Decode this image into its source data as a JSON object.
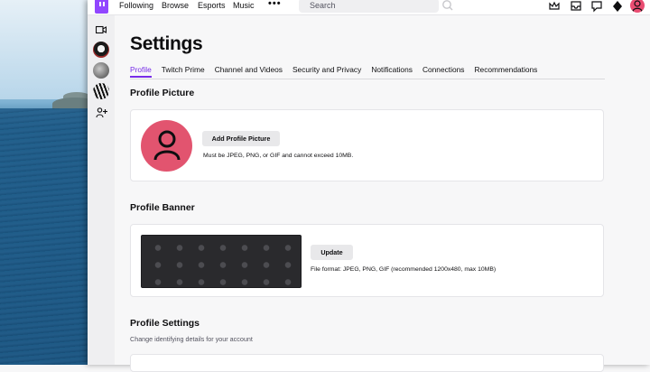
{
  "nav": {
    "links": [
      "Following",
      "Browse",
      "Esports",
      "Music"
    ],
    "more_label": "•••",
    "search_placeholder": "Search"
  },
  "page": {
    "title": "Settings",
    "tabs": [
      {
        "label": "Profile",
        "active": true
      },
      {
        "label": "Twitch Prime",
        "active": false
      },
      {
        "label": "Channel and Videos",
        "active": false
      },
      {
        "label": "Security and Privacy",
        "active": false
      },
      {
        "label": "Notifications",
        "active": false
      },
      {
        "label": "Connections",
        "active": false
      },
      {
        "label": "Recommendations",
        "active": false
      }
    ]
  },
  "profile_picture": {
    "title": "Profile Picture",
    "button": "Add Profile Picture",
    "hint": "Must be JPEG, PNG, or GIF and cannot exceed 10MB."
  },
  "profile_banner": {
    "title": "Profile Banner",
    "button": "Update",
    "hint": "File format: JPEG, PNG, GIF (recommended 1200x480, max 10MB)"
  },
  "profile_settings": {
    "title": "Profile Settings",
    "subtitle": "Change identifying details for your account"
  },
  "colors": {
    "accent": "#772ce8",
    "brand": "#9146ff",
    "avatar": "#e2546f"
  },
  "icons": [
    "twitch-logo-icon",
    "search-icon",
    "crown-icon",
    "inbox-icon",
    "whispers-icon",
    "bits-icon",
    "camera-icon",
    "friends-icon"
  ]
}
